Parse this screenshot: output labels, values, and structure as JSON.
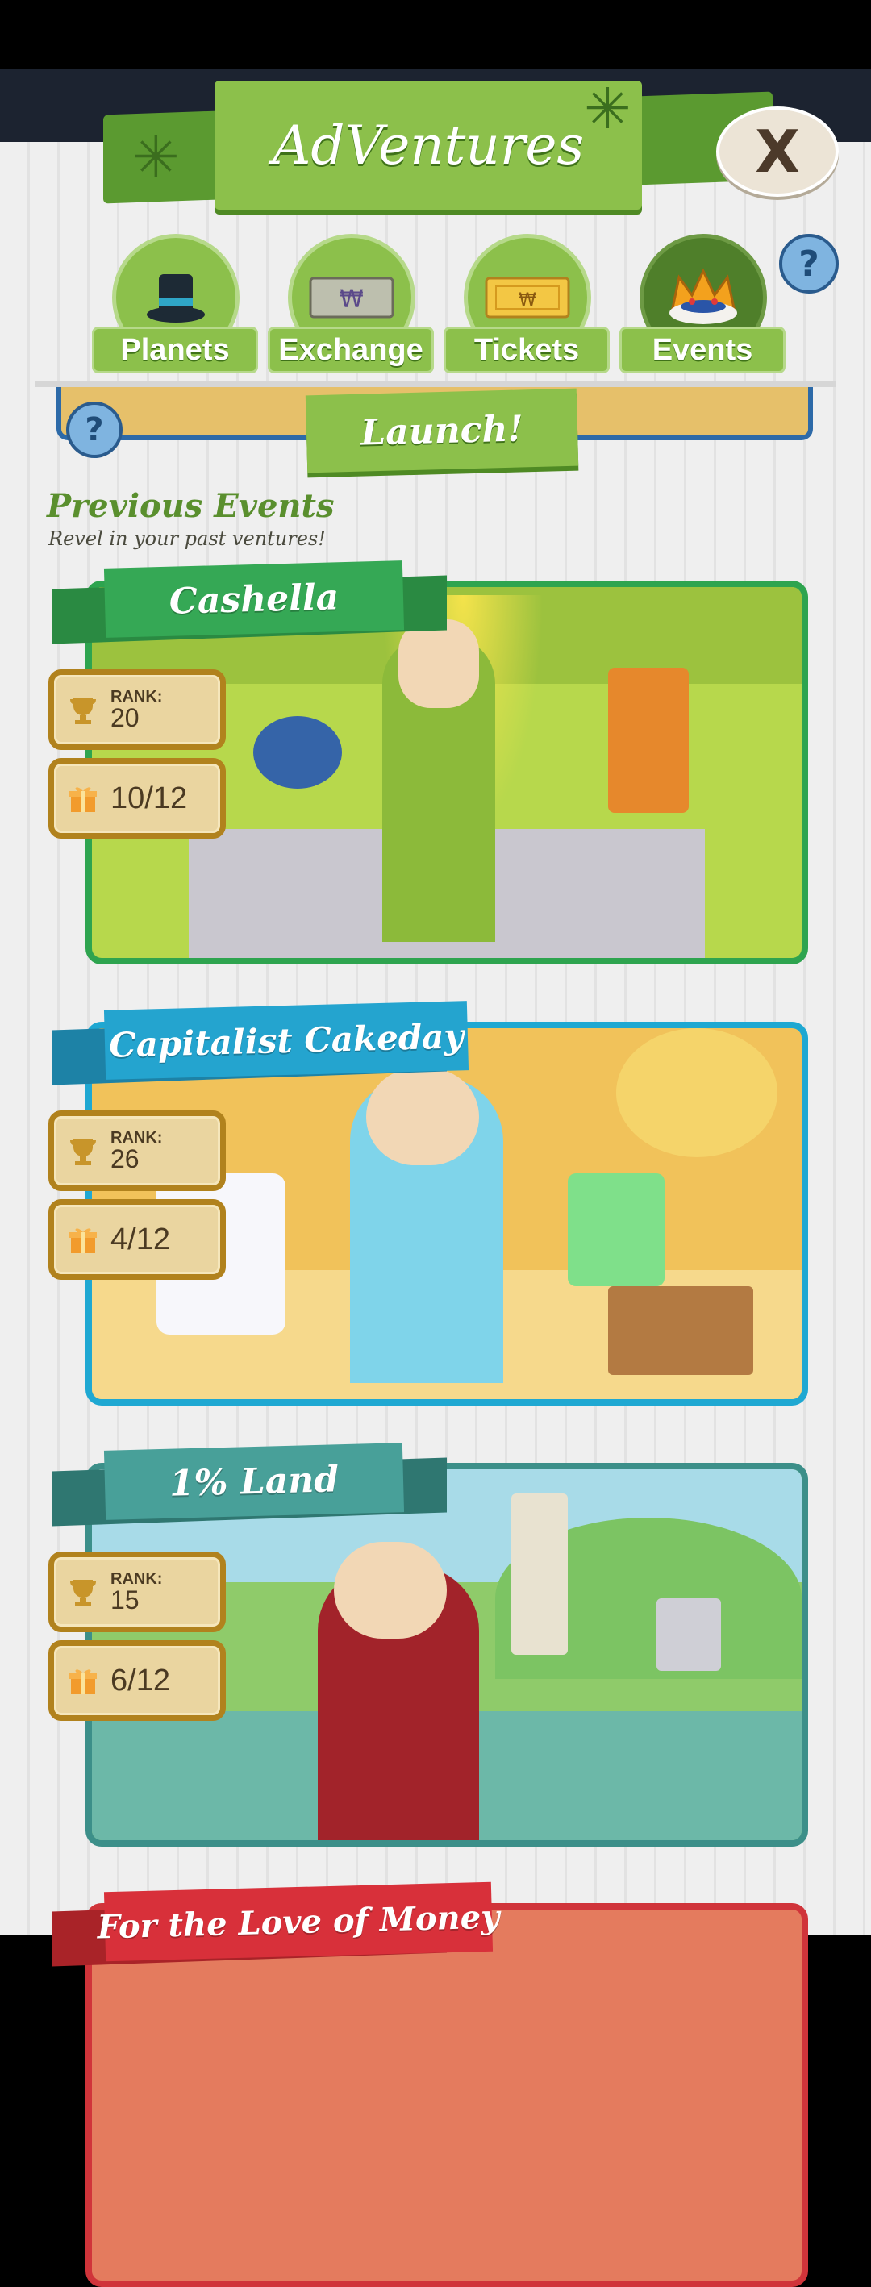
{
  "header": {
    "title": "AdVentures",
    "close_label": "X",
    "help_label": "?"
  },
  "tabs": [
    {
      "label": "Planets",
      "icon": "top-hat-icon",
      "active": false
    },
    {
      "label": "Exchange",
      "icon": "money-bill-icon",
      "active": false
    },
    {
      "label": "Tickets",
      "icon": "ticket-icon",
      "active": false
    },
    {
      "label": "Events",
      "icon": "crown-icon",
      "active": true
    }
  ],
  "launch": {
    "label": "Launch!",
    "help_label": "?"
  },
  "previous": {
    "title": "Previous Events",
    "subtitle": "Revel in your past ventures!"
  },
  "events": [
    {
      "name": "Cashella",
      "rank_label": "RANK:",
      "rank": "20",
      "tickets": "10/12",
      "frame": "#2ea44f",
      "banner": "#35a855",
      "banner_dark": "#2a8a42",
      "art": "#b7d84c"
    },
    {
      "name": "Capitalist Cakeday",
      "rank_label": "RANK:",
      "rank": "26",
      "tickets": "4/12",
      "frame": "#1fa8d2",
      "banner": "#24a4cf",
      "banner_dark": "#1d82a6",
      "art": "#f1c25a"
    },
    {
      "name": "1% Land",
      "rank_label": "RANK:",
      "rank": "15",
      "tickets": "6/12",
      "frame": "#3c8f89",
      "banner": "#48a099",
      "banner_dark": "#2f7771",
      "art": "#8fcb6a"
    },
    {
      "name": "For the Love of Money",
      "frame": "#d0343a",
      "banner": "#d8303a",
      "banner_dark": "#a92328",
      "art": "#e47b5e"
    }
  ]
}
